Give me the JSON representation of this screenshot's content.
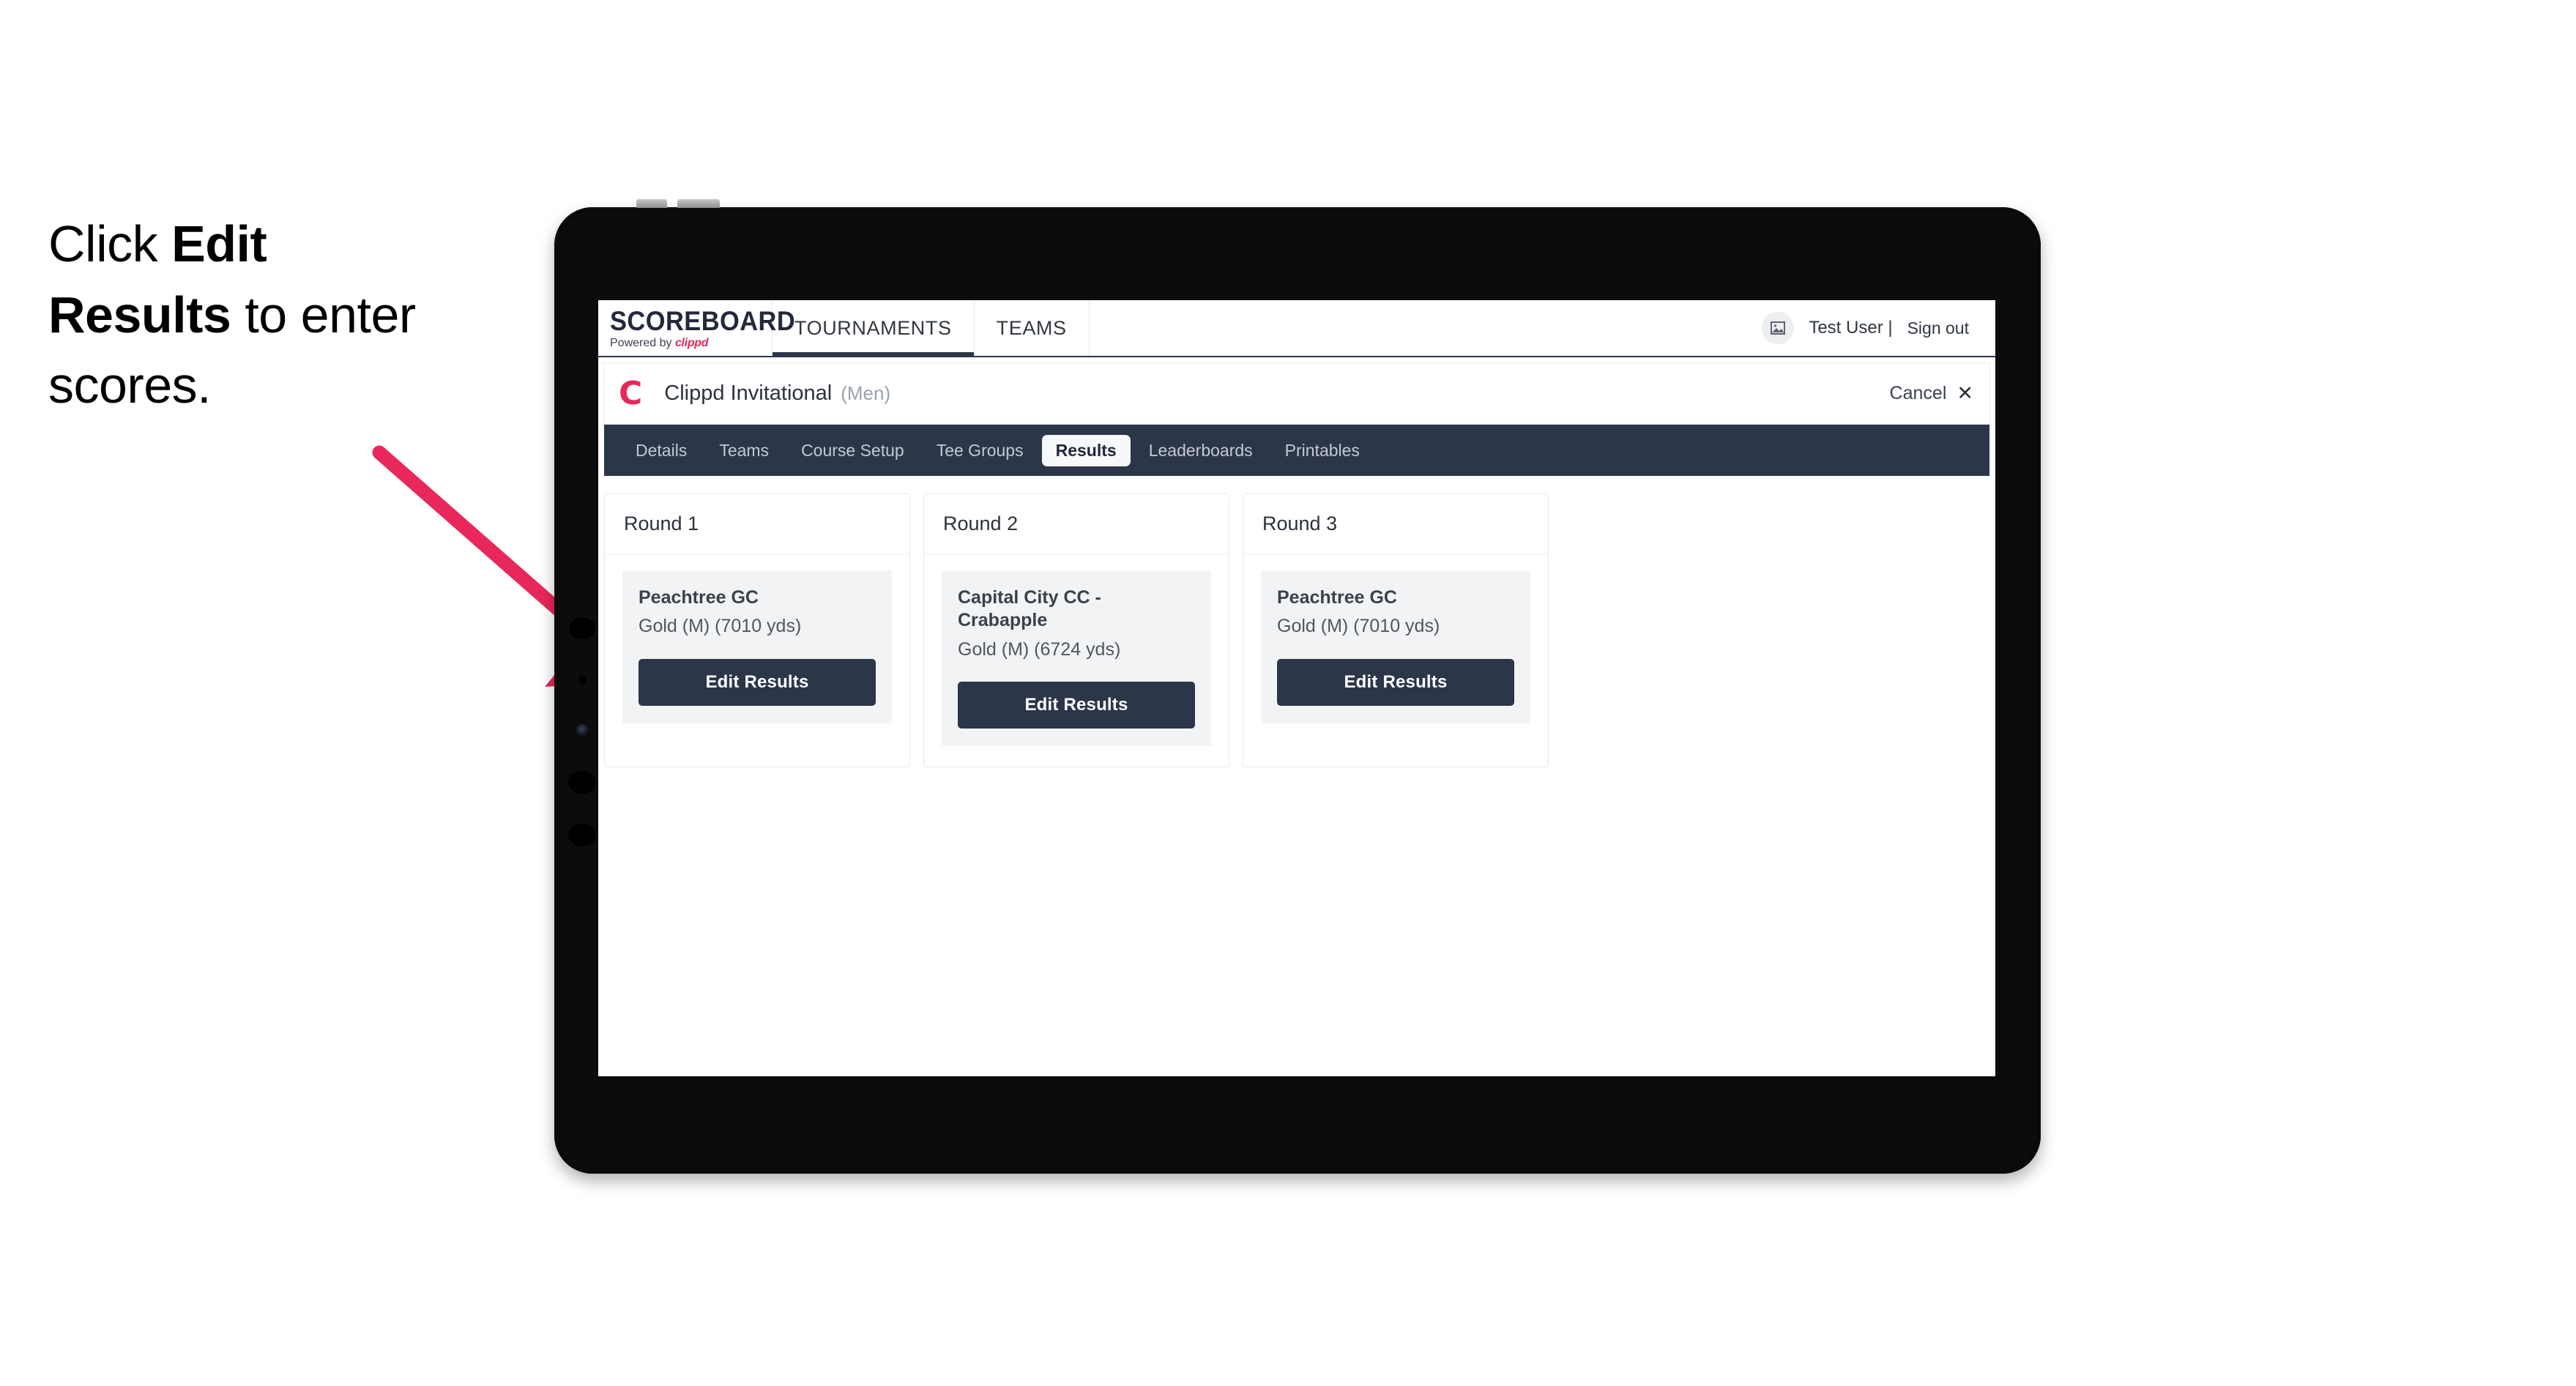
{
  "annotation": {
    "text_before": "Click ",
    "text_bold": "Edit Results",
    "text_after": " to enter scores.",
    "arrow_color": "#e8275a"
  },
  "appbar": {
    "brand_name": "SCOREBOARD",
    "brand_powered_prefix": "Powered by ",
    "brand_powered_name": "clippd",
    "nav_tabs": [
      {
        "label": "TOURNAMENTS",
        "active": true
      },
      {
        "label": "TEAMS",
        "active": false
      }
    ],
    "avatar_icon": "image-placeholder-icon",
    "user_name": "Test User |",
    "sign_out_label": "Sign out"
  },
  "tournament_header": {
    "logo_letter": "C",
    "title": "Clippd Invitational",
    "gender": "(Men)",
    "cancel_label": "Cancel",
    "close_icon": "close-icon"
  },
  "subtabs": [
    {
      "label": "Details",
      "active": false
    },
    {
      "label": "Teams",
      "active": false
    },
    {
      "label": "Course Setup",
      "active": false
    },
    {
      "label": "Tee Groups",
      "active": false
    },
    {
      "label": "Results",
      "active": true
    },
    {
      "label": "Leaderboards",
      "active": false
    },
    {
      "label": "Printables",
      "active": false
    }
  ],
  "rounds": [
    {
      "round_title": "Round 1",
      "course_name": "Peachtree GC",
      "course_tee": "Gold (M) (7010 yds)",
      "edit_label": "Edit Results"
    },
    {
      "round_title": "Round 2",
      "course_name": "Capital City CC - Crabapple",
      "course_tee": "Gold (M) (6724 yds)",
      "edit_label": "Edit Results"
    },
    {
      "round_title": "Round 3",
      "course_name": "Peachtree GC",
      "course_tee": "Gold (M) (7010 yds)",
      "edit_label": "Edit Results"
    }
  ],
  "colors": {
    "navy": "#2b3648",
    "accent_pink": "#e8275a",
    "panel_grey": "#f2f3f5",
    "device_black": "#0c0c0c"
  }
}
